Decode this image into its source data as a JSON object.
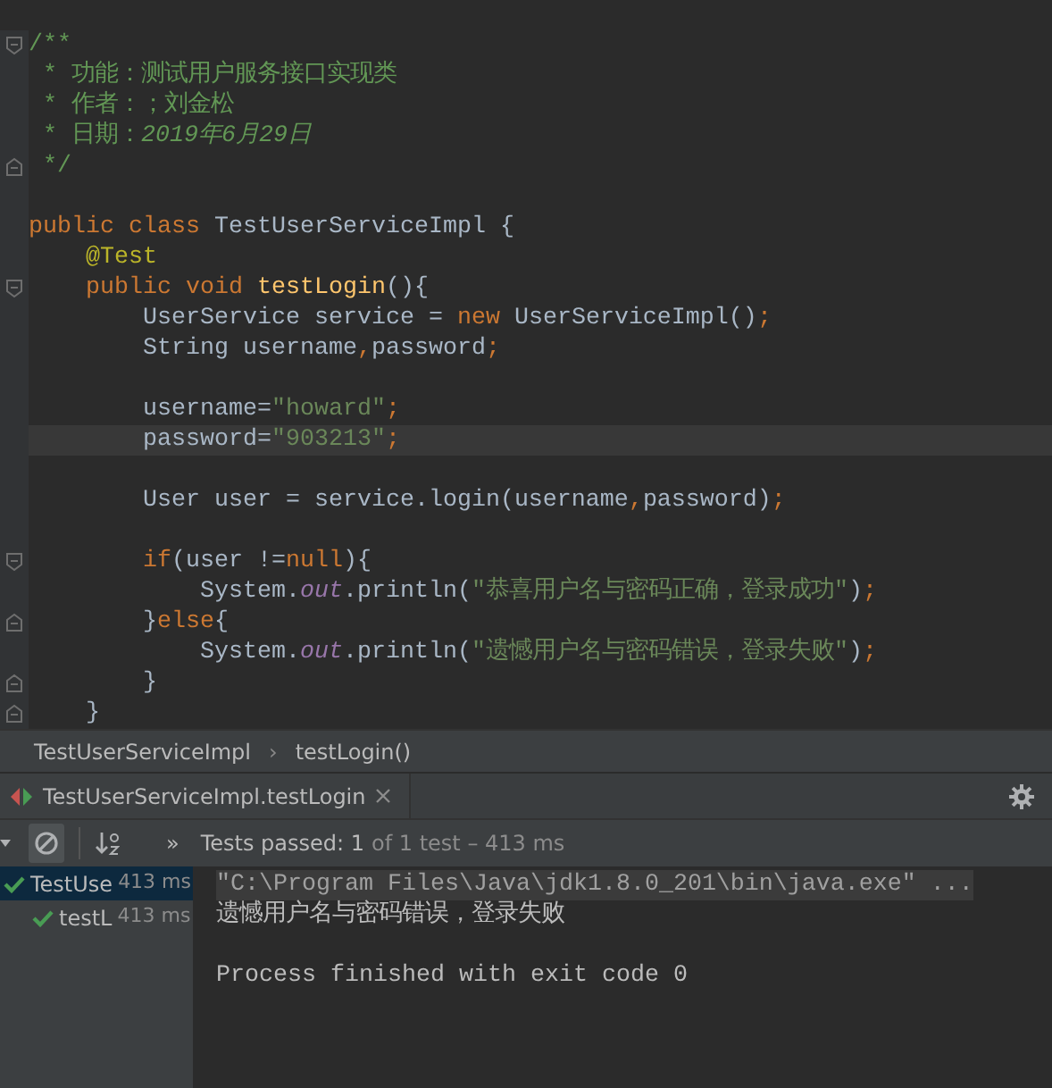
{
  "editor": {
    "lines": [
      {
        "fold": {
          "kind": "start"
        },
        "current": false,
        "tokens": [
          {
            "text": "/**",
            "kind": "doc"
          }
        ]
      },
      {
        "current": false,
        "tokens": [
          {
            "text": " * 功能：测试用户服务接口实现类",
            "kind": "doc"
          }
        ]
      },
      {
        "current": false,
        "tokens": [
          {
            "text": " * 作者：；刘金松",
            "kind": "doc"
          }
        ]
      },
      {
        "current": false,
        "tokens": [
          {
            "text": " * 日期：",
            "kind": "doc"
          },
          {
            "text": "2019年6月29日",
            "kind": "doc-em"
          }
        ]
      },
      {
        "fold": {
          "kind": "end"
        },
        "current": false,
        "tokens": [
          {
            "text": " */",
            "kind": "doc"
          }
        ]
      },
      {
        "current": false
      },
      {
        "current": false,
        "tokens": [
          {
            "text": "public class ",
            "kind": "keyword"
          },
          {
            "text": "TestUserServiceImpl {",
            "kind": "plain"
          }
        ]
      },
      {
        "current": false,
        "tokens": [
          {
            "text": "    @Test",
            "kind": "annotation"
          }
        ]
      },
      {
        "fold": {
          "kind": "start"
        },
        "current": false,
        "tokens": [
          {
            "text": "    public void ",
            "kind": "keyword"
          },
          {
            "text": "testLogin",
            "kind": "method"
          },
          {
            "text": "(){",
            "kind": "plain"
          }
        ]
      },
      {
        "current": false,
        "tokens": [
          {
            "text": "        UserService service = ",
            "kind": "plain"
          },
          {
            "text": "new ",
            "kind": "keyword"
          },
          {
            "text": "UserServiceImpl()",
            "kind": "plain"
          },
          {
            "text": ";",
            "kind": "punct"
          }
        ]
      },
      {
        "current": false,
        "tokens": [
          {
            "text": "        String username",
            "kind": "plain"
          },
          {
            "text": ",",
            "kind": "punct"
          },
          {
            "text": "password",
            "kind": "plain"
          },
          {
            "text": ";",
            "kind": "punct"
          }
        ]
      },
      {
        "current": false
      },
      {
        "current": false,
        "tokens": [
          {
            "text": "        username=",
            "kind": "plain"
          },
          {
            "text": "\"howard\"",
            "kind": "string"
          },
          {
            "text": ";",
            "kind": "punct"
          }
        ]
      },
      {
        "current": true,
        "tokens": [
          {
            "text": "        password=",
            "kind": "plain"
          },
          {
            "text": "\"903213\"",
            "kind": "string"
          },
          {
            "text": ";",
            "kind": "punct"
          }
        ]
      },
      {
        "current": false
      },
      {
        "current": false,
        "tokens": [
          {
            "text": "        User user = service.login(username",
            "kind": "plain"
          },
          {
            "text": ",",
            "kind": "punct"
          },
          {
            "text": "password)",
            "kind": "plain"
          },
          {
            "text": ";",
            "kind": "punct"
          }
        ]
      },
      {
        "current": false
      },
      {
        "fold": {
          "kind": "start"
        },
        "current": false,
        "tokens": [
          {
            "text": "        if",
            "kind": "keyword"
          },
          {
            "text": "(user !=",
            "kind": "plain"
          },
          {
            "text": "null",
            "kind": "keyword"
          },
          {
            "text": "){",
            "kind": "plain"
          }
        ]
      },
      {
        "current": false,
        "tokens": [
          {
            "text": "            System.",
            "kind": "plain"
          },
          {
            "text": "out",
            "kind": "field"
          },
          {
            "text": ".println(",
            "kind": "plain"
          },
          {
            "text": "\"恭喜用户名与密码正确，登录成功\"",
            "kind": "string"
          },
          {
            "text": ")",
            "kind": "plain"
          },
          {
            "text": ";",
            "kind": "punct"
          }
        ]
      },
      {
        "fold": {
          "kind": "end"
        },
        "current": false,
        "tokens": [
          {
            "text": "        }",
            "kind": "plain"
          },
          {
            "text": "else",
            "kind": "keyword"
          },
          {
            "text": "{",
            "kind": "plain"
          }
        ]
      },
      {
        "current": false,
        "tokens": [
          {
            "text": "            System.",
            "kind": "plain"
          },
          {
            "text": "out",
            "kind": "field"
          },
          {
            "text": ".println(",
            "kind": "plain"
          },
          {
            "text": "\"遗憾用户名与密码错误，登录失败\"",
            "kind": "string"
          },
          {
            "text": ")",
            "kind": "plain"
          },
          {
            "text": ";",
            "kind": "punct"
          }
        ]
      },
      {
        "fold": {
          "kind": "end"
        },
        "current": false,
        "tokens": [
          {
            "text": "        }",
            "kind": "plain"
          }
        ]
      },
      {
        "fold": {
          "kind": "end"
        },
        "current": false,
        "tokens": [
          {
            "text": "    }",
            "kind": "plain"
          }
        ]
      }
    ]
  },
  "breadcrumbs": {
    "items": [
      "TestUserServiceImpl",
      "testLogin()"
    ],
    "separator": "›"
  },
  "run_tab": {
    "label": "TestUserServiceImpl.testLogin"
  },
  "toolbar": {
    "more": "»",
    "passed_label": "Tests passed: 1",
    "detail": "of 1 test – 413 ms"
  },
  "test_tree": [
    {
      "name": "TestUse",
      "time": "413 ms",
      "selected": true,
      "children": [
        {
          "name": "testL",
          "time": "413 ms",
          "selected": false
        }
      ]
    }
  ],
  "console": [
    {
      "text": "\"C:\\Program Files\\Java\\jdk1.8.0_201\\bin\\java.exe\" ...",
      "kind": "command"
    },
    {
      "text": "遗憾用户名与密码错误，登录失败",
      "kind": "output"
    },
    {
      "kind": "blank"
    },
    {
      "text": "Process finished with exit code 0",
      "kind": "output"
    }
  ]
}
